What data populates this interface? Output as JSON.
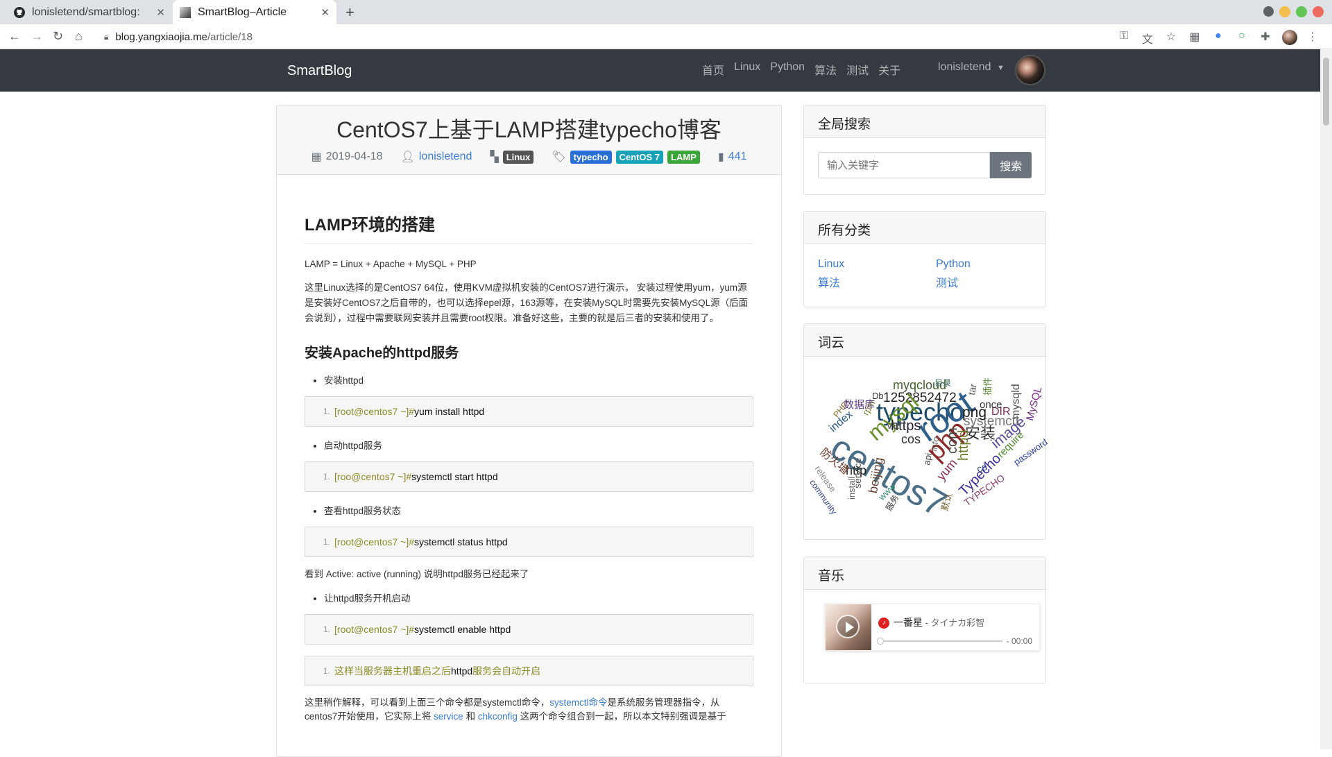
{
  "browser": {
    "tabs": [
      {
        "title": "lonisletend/smartblog:",
        "icon": "github-icon"
      },
      {
        "title": "SmartBlog–Article",
        "icon": "favicon-icon"
      }
    ],
    "url_host": "blog.yangxiaojia.me",
    "url_path": "/article/18"
  },
  "site": {
    "brand": "SmartBlog",
    "nav": [
      "首页",
      "Linux",
      "Python",
      "算法",
      "测试",
      "关于"
    ],
    "user": "lonisletend"
  },
  "article": {
    "title": "CentOS7上基于LAMP搭建typecho博客",
    "date": "2019-04-18",
    "author": "lonisletend",
    "category": "Linux",
    "tags": [
      "typecho",
      "CentOS 7",
      "LAMP"
    ],
    "views": "441",
    "h2": "LAMP环境的搭建",
    "p1": "LAMP = Linux + Apache + MySQL + PHP",
    "p2": "这里Linux选择的是CentOS7 64位，使用KVM虚拟机安装的CentOS7进行演示， 安装过程使用yum，yum源是安装好CentOS7之后自带的，也可以选择epel源，163源等，在安装MySQL时需要先安装MySQL源（后面会说到），过程中需要联网安装并且需要root权限。准备好这些，主要的就是后三者的安装和使用了。",
    "h3": "安装Apache的httpd服务",
    "steps": [
      {
        "bullet": "安装httpd",
        "prompt": "[root@centos7 ~]#",
        "cmd": " yum install httpd"
      },
      {
        "bullet": "启动httpd服务",
        "prompt": "[roo@centos7 ~]#",
        "cmd": " systemctl start httpd"
      },
      {
        "bullet": "查看httpd服务状态",
        "prompt": "[root@centos7 ~]#",
        "cmd": " systemctl status httpd"
      }
    ],
    "note": "看到 Active: active (running) 说明httpd服务已经起来了",
    "bullet4": "让httpd服务开机启动",
    "code4_prompt": "[root@centos7 ~]#",
    "code4_cmd": " systemctl enable httpd",
    "code5_a": "这样当服务器主机重启之后",
    "code5_b": "httpd",
    "code5_c": "服务会自动开启",
    "p3_a": "这里稍作解释，可以看到上面三个命令都是systemctl命令，",
    "p3_link": "systemctl命令",
    "p3_b": "是系统服务管理器指令，从",
    "p4_a": "centos7开始使用，它实际上将 ",
    "p4_link1": "service",
    "p4_b": " 和 ",
    "p4_link2": "chkconfig",
    "p4_c": " 这两个命令组合到一起，所以本文特别强调是基于"
  },
  "sidebar": {
    "search_title": "全局搜索",
    "search_placeholder": "输入关键字",
    "search_button": "搜索",
    "cats_title": "所有分类",
    "categories": [
      "Linux",
      "Python",
      "算法",
      "测试"
    ],
    "cloud_title": "词云",
    "music_title": "音乐",
    "song": "一番星",
    "artist": " - タイナカ彩智",
    "time": "- 00:00"
  },
  "wordcloud": [
    {
      "t": "myqcloud",
      "c": "#3f5f2f"
    },
    {
      "t": "1252852472",
      "c": "#222"
    },
    {
      "t": "typecho",
      "c": "#1e4d6b"
    },
    {
      "t": "centos7",
      "c": "#4a6f87"
    },
    {
      "t": "root",
      "c": "#2e5f8a"
    },
    {
      "t": "php",
      "c": "#8a2a2a"
    },
    {
      "t": "mysql",
      "c": "#6a8f2a"
    },
    {
      "t": "https",
      "c": "#223"
    },
    {
      "t": "安装",
      "c": "#333"
    },
    {
      "t": "systemctl",
      "c": "#777"
    },
    {
      "t": "cos",
      "c": "#333"
    },
    {
      "t": "var",
      "c": "#555"
    },
    {
      "t": "png",
      "c": "#222"
    },
    {
      "t": "DIR",
      "c": "#7a2a5a"
    },
    {
      "t": "once",
      "c": "#333"
    },
    {
      "t": "数据库",
      "c": "#5a3a8a"
    },
    {
      "t": "Db",
      "c": "#333"
    },
    {
      "t": "image",
      "c": "#5a4a9a"
    },
    {
      "t": "mysqld",
      "c": "#555"
    },
    {
      "t": "MySQL",
      "c": "#7a2a8a"
    },
    {
      "t": "require",
      "c": "#4a8a2a"
    },
    {
      "t": "password",
      "c": "#2a3a9a"
    },
    {
      "t": "httpd",
      "c": "#6a7a2a"
    },
    {
      "t": "com",
      "c": "#444"
    },
    {
      "t": "yum",
      "c": "#8a2a4a"
    },
    {
      "t": "Typecho",
      "c": "#3a2a9a"
    },
    {
      "t": "TYPECHO",
      "c": "#8a3a6a"
    },
    {
      "t": "http",
      "c": "#222"
    },
    {
      "t": "index",
      "c": "#2a5a8a"
    },
    {
      "t": "防火墙",
      "c": "#6a3a2a"
    },
    {
      "t": "release",
      "c": "#888"
    },
    {
      "t": "community",
      "c": "#2a3a8a"
    },
    {
      "t": "service",
      "c": "#555"
    },
    {
      "t": "beijing",
      "c": "#6a4a3a"
    },
    {
      "t": "install",
      "c": "#666"
    },
    {
      "t": "www",
      "c": "#2a8a6a"
    },
    {
      "t": "info",
      "c": "#6a6a6a"
    },
    {
      "t": "cd",
      "c": "#2a4a8a"
    },
    {
      "t": "api",
      "c": "#444"
    },
    {
      "t": "默认",
      "c": "#6a5a2a"
    },
    {
      "t": "服务",
      "c": "#444"
    },
    {
      "t": "rpm",
      "c": "#7a7a3a"
    },
    {
      "t": "PHP",
      "c": "#8a6a2a"
    },
    {
      "t": "tar",
      "c": "#555"
    },
    {
      "t": "插件",
      "c": "#5a8a3a"
    },
    {
      "t": "目录",
      "c": "#3a6a5a"
    }
  ]
}
